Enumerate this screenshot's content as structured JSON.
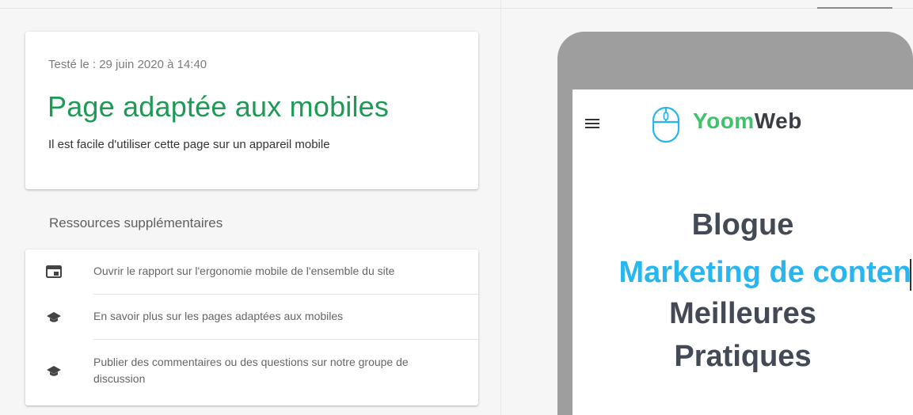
{
  "result": {
    "tested_on": "Testé le : 29 juin 2020 à 14:40",
    "verdict": "Page adaptée aux mobiles",
    "description": "Il est facile d'utiliser cette page sur un appareil mobile"
  },
  "resources": {
    "title": "Ressources supplémentaires",
    "items": [
      {
        "icon": "report-icon",
        "label": "Ouvrir le rapport sur l'ergonomie mobile de l'ensemble du site"
      },
      {
        "icon": "graduation-cap-icon",
        "label": "En savoir plus sur les pages adaptées aux mobiles"
      },
      {
        "icon": "graduation-cap-icon",
        "label": "Publier des commentaires ou des questions sur notre groupe de discussion"
      }
    ]
  },
  "preview": {
    "menu_icon": "hamburger-menu-icon",
    "logo": {
      "icon": "mouse-icon",
      "part1": "Yoom",
      "part2": "Web"
    },
    "headline": {
      "line1": "Blogue",
      "line2": "Marketing de conten",
      "line3": "Meilleures",
      "line4": "Pratiques"
    }
  },
  "colors": {
    "verdict_green": "#1e9a56",
    "headline_blue": "#29b6ef",
    "headline_dark": "#444a55",
    "logo_green": "#3ec26a"
  }
}
